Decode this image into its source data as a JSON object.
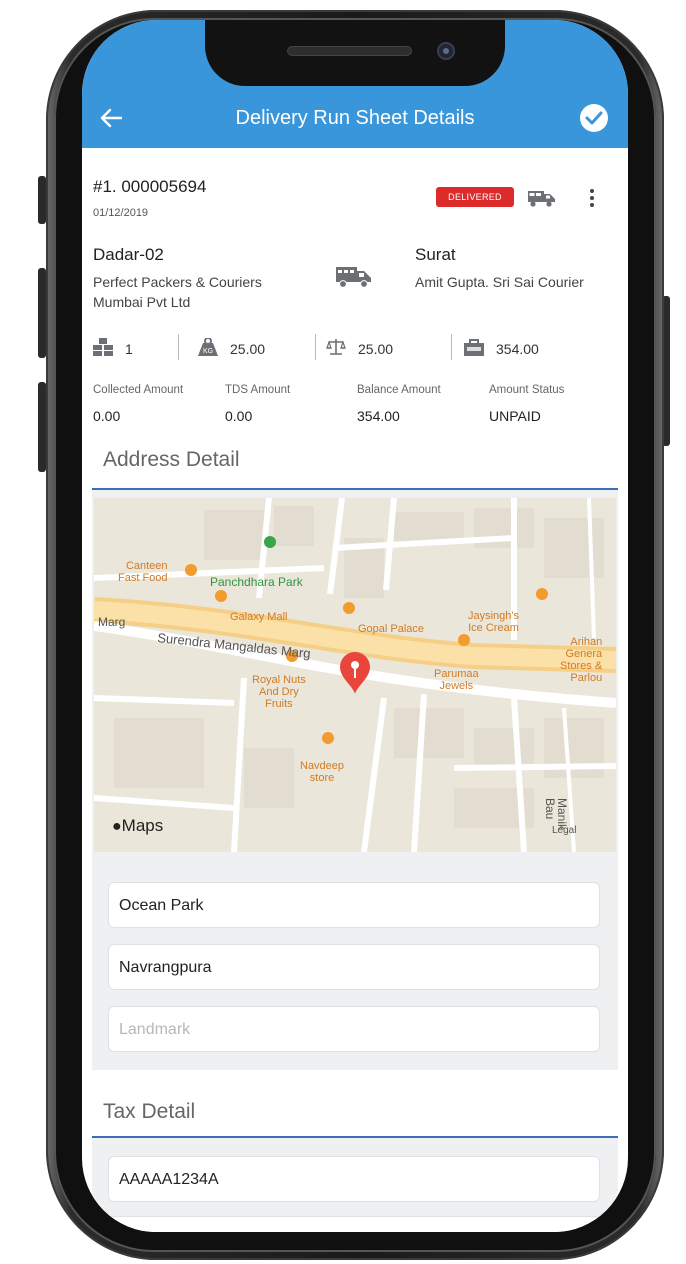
{
  "appbar": {
    "title": "Delivery Run Sheet Details",
    "back_icon": "arrow-left-icon",
    "confirm_icon": "check-circle-icon",
    "color": "#3a96db"
  },
  "drs": {
    "number": "#1. 000005694",
    "date": "01/12/2019",
    "status": "DELIVERED",
    "status_color": "#dd2a2a"
  },
  "route": {
    "from_city": "Dadar-02",
    "from_party": "Perfect Packers & Couriers Mumbai Pvt Ltd",
    "to_city": "Surat",
    "to_party": "Amit Gupta. Sri Sai Courier"
  },
  "metrics": {
    "packages": "1",
    "weight": "25.00",
    "charged_weight": "25.00",
    "amount": "354.00"
  },
  "amounts": {
    "collected_label": "Collected Amount",
    "collected_value": "0.00",
    "tds_label": "TDS Amount",
    "tds_value": "0.00",
    "balance_label": "Balance Amount",
    "balance_value": "354.00",
    "status_label": "Amount Status",
    "status_value": "UNPAID"
  },
  "address": {
    "section_title": "Address Detail",
    "line1": "Ocean Park",
    "line2": "Navrangpura",
    "landmark_placeholder": "Landmark"
  },
  "map": {
    "attribution": "Maps",
    "legal": "Legal",
    "labels": {
      "canteen": "Canteen\nFast Food",
      "panchdhara": "Panchdhara Park",
      "galaxy": "Galaxy Mall",
      "gopal": "Gopal Palace",
      "jaysingh": "Jaysingh's\nIce Cream",
      "arihan": "Arihan\nGenera\nStores &\nParlou",
      "marg_left": "Marg",
      "surendra": "Surendra Mangaldas Marg",
      "parumaa": "Parumaa\nJewels",
      "royal": "Royal Nuts\nAnd Dry\nFruits",
      "navdeep": "Navdeep\nstore",
      "manik": "Manik Bau"
    }
  },
  "tax": {
    "section_title": "Tax Detail",
    "pan": "AAAAA1234A"
  }
}
